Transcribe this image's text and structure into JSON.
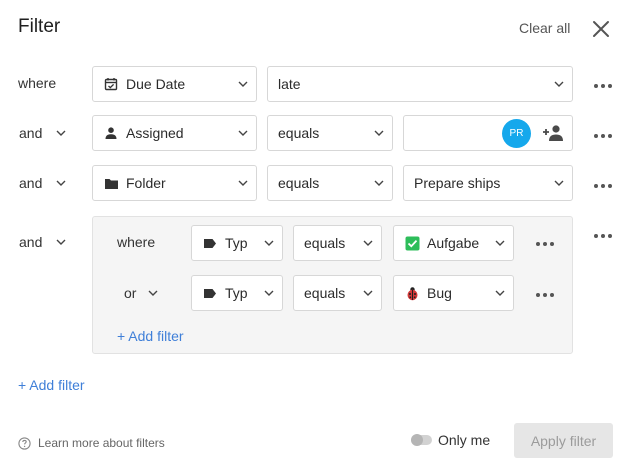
{
  "header": {
    "title": "Filter",
    "clear_all_label": "Clear all"
  },
  "rows": [
    {
      "connector": "where",
      "field": {
        "label": "Due Date",
        "icon": "calendar-icon"
      },
      "operator": "late"
    },
    {
      "connector": "and",
      "field": {
        "label": "Assigned",
        "icon": "person-icon"
      },
      "operator": "equals",
      "value": {
        "avatar_initials": "PR",
        "avatar_color": "#15a8ec"
      }
    },
    {
      "connector": "and",
      "field": {
        "label": "Folder",
        "icon": "folder-icon"
      },
      "operator": "equals",
      "value": {
        "label": "Prepare ships"
      }
    },
    {
      "connector": "and"
    }
  ],
  "group": {
    "rows": [
      {
        "connector": "where",
        "field": {
          "label": "Typ",
          "icon": "tag-icon"
        },
        "operator": "equals",
        "value": {
          "label": "Aufgabe",
          "icon": "checkbox-checked-icon"
        }
      },
      {
        "connector": "or",
        "field": {
          "label": "Typ",
          "icon": "tag-icon"
        },
        "operator": "equals",
        "value": {
          "label": "Bug",
          "icon": "ladybug-icon"
        }
      }
    ],
    "add_filter_label": "+ Add filter"
  },
  "add_filter_label": "+ Add filter",
  "footer": {
    "help_label": "Learn more about filters",
    "only_me_label": "Only me",
    "only_me_checked": false,
    "apply_label": "Apply filter"
  },
  "colors": {
    "accent": "#3f7fd8",
    "avatar": "#15a8ec",
    "check": "#2dbd5a",
    "bug": "#d23a3a"
  }
}
